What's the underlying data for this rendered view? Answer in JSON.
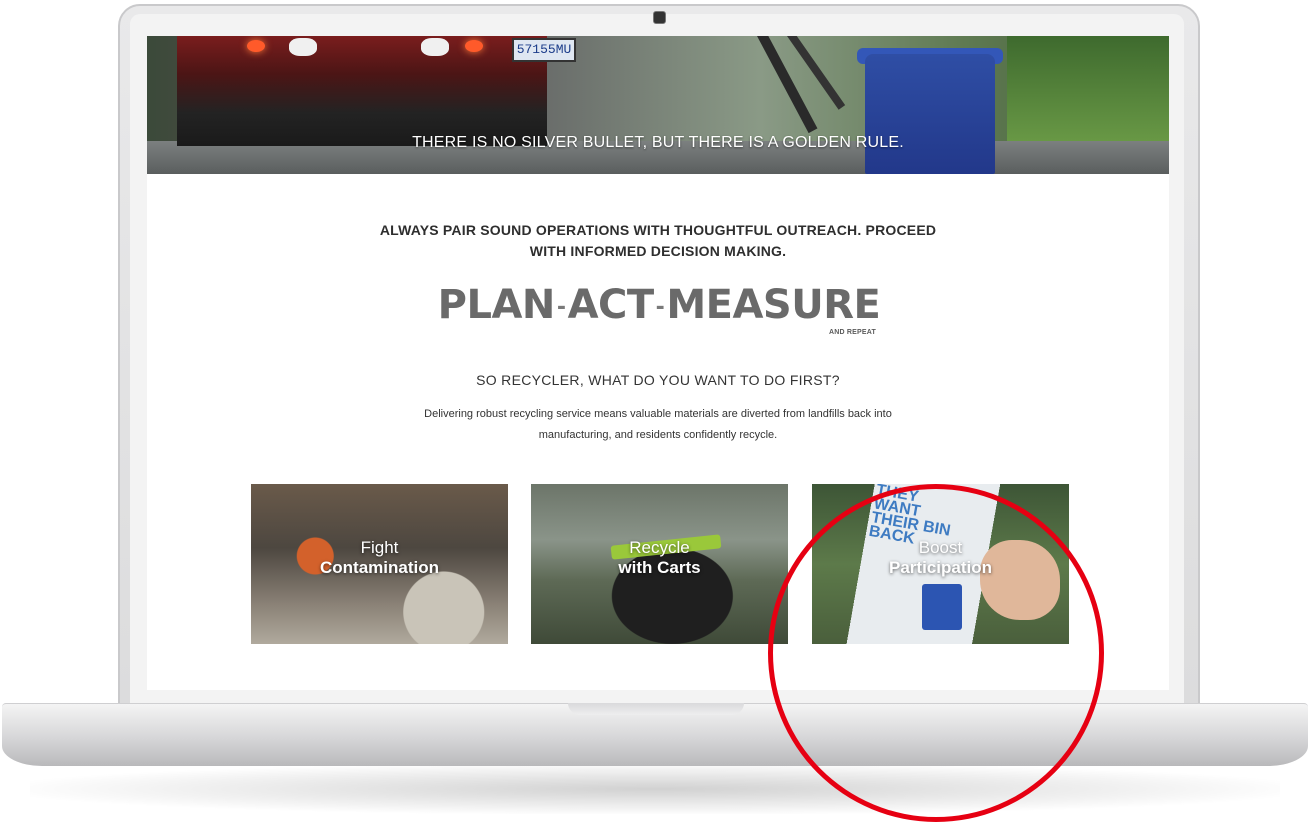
{
  "hero": {
    "caption": "THERE IS NO SILVER BULLET, BUT THERE IS A GOLDEN RULE.",
    "plate_text": "57155MU"
  },
  "intro": {
    "lead_line1": "ALWAYS PAIR SOUND OPERATIONS WITH THOUGHTFUL OUTREACH.  PROCEED",
    "lead_line2": "WITH INFORMED DECISION MAKING."
  },
  "logo": {
    "word1": "PLAN",
    "word2": "ACT",
    "word3": "MEASURE",
    "separator": "-",
    "tagline": "AND REPEAT"
  },
  "section": {
    "question": "SO RECYCLER, WHAT DO YOU WANT TO DO FIRST?",
    "description_line1": "Delivering robust recycling service means valuable materials are diverted from landfills back into",
    "description_line2": "manufacturing, and residents confidently recycle."
  },
  "tiles": [
    {
      "line1": "Fight",
      "line2": "Contamination"
    },
    {
      "line1": "Recycle",
      "line2": "with Carts"
    },
    {
      "line1": "Boost",
      "line2": "Participation",
      "card_text": "THEY WANT THEIR BIN BACK"
    }
  ],
  "colors": {
    "annotation": "#e60012",
    "text_dark": "#2e2e2e",
    "logo_gray": "#6a6a6a"
  }
}
